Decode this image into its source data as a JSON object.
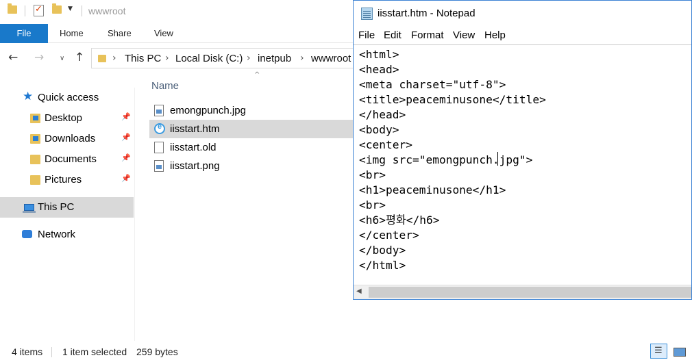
{
  "explorer": {
    "window_title": "wwwroot",
    "ribbon_tabs": [
      "File",
      "Home",
      "Share",
      "View"
    ],
    "breadcrumbs": [
      "This PC",
      "Local Disk (C:)",
      "inetpub",
      "wwwroot"
    ],
    "nav": {
      "quick_access": "Quick access",
      "items": [
        "Desktop",
        "Downloads",
        "Documents",
        "Pictures"
      ],
      "this_pc": "This PC",
      "network": "Network"
    },
    "column_name": "Name",
    "files": [
      "emongpunch.jpg",
      "iisstart.htm",
      "iisstart.old",
      "iisstart.png"
    ],
    "selected_file": "iisstart.htm",
    "status": {
      "item_count": "4 items",
      "selected_count": "1 item selected",
      "selected_size": "259 bytes"
    }
  },
  "notepad": {
    "title": "iisstart.htm - Notepad",
    "menu": [
      "File",
      "Edit",
      "Format",
      "View",
      "Help"
    ],
    "content": "<html>\n<head>\n<meta charset=\"utf-8\">\n<title>peaceminusone</title>\n</head>\n<body>\n<center>\n<img src=\"emongpunch.jpg\">\n<br>\n<h1>peaceminusone</h1>\n<br>\n<h6>평화</h6>\n</center>\n</body>\n</html>"
  }
}
